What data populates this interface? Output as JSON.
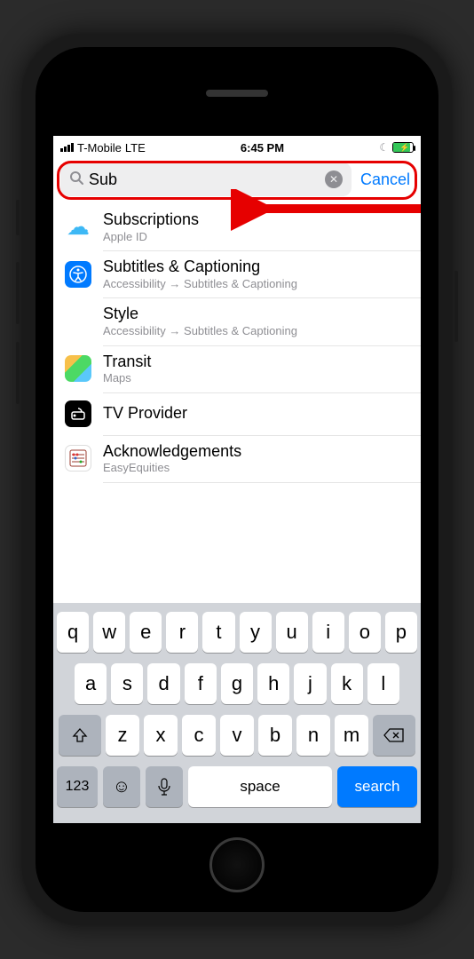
{
  "status": {
    "carrier": "T-Mobile",
    "network": "LTE",
    "time": "6:45 PM"
  },
  "search": {
    "value": "Sub",
    "cancel": "Cancel"
  },
  "results": [
    {
      "title": "Subscriptions",
      "subtitle": "Apple ID",
      "icon": "cloud-icon"
    },
    {
      "title": "Subtitles & Captioning",
      "subtitle": "Accessibility → Subtitles & Captioning",
      "icon": "accessibility-icon"
    },
    {
      "title": "Style",
      "subtitle": "Accessibility → Subtitles & Captioning",
      "icon": ""
    },
    {
      "title": "Transit",
      "subtitle": "Maps",
      "icon": "maps-icon"
    },
    {
      "title": "TV Provider",
      "subtitle": "",
      "icon": "tv-provider-icon"
    },
    {
      "title": "Acknowledgements",
      "subtitle": "EasyEquities",
      "icon": "abacus-icon"
    }
  ],
  "keyboard": {
    "row1": [
      "q",
      "w",
      "e",
      "r",
      "t",
      "y",
      "u",
      "i",
      "o",
      "p"
    ],
    "row2": [
      "a",
      "s",
      "d",
      "f",
      "g",
      "h",
      "j",
      "k",
      "l"
    ],
    "row3": [
      "z",
      "x",
      "c",
      "v",
      "b",
      "n",
      "m"
    ],
    "numKey": "123",
    "space": "space",
    "search": "search"
  }
}
